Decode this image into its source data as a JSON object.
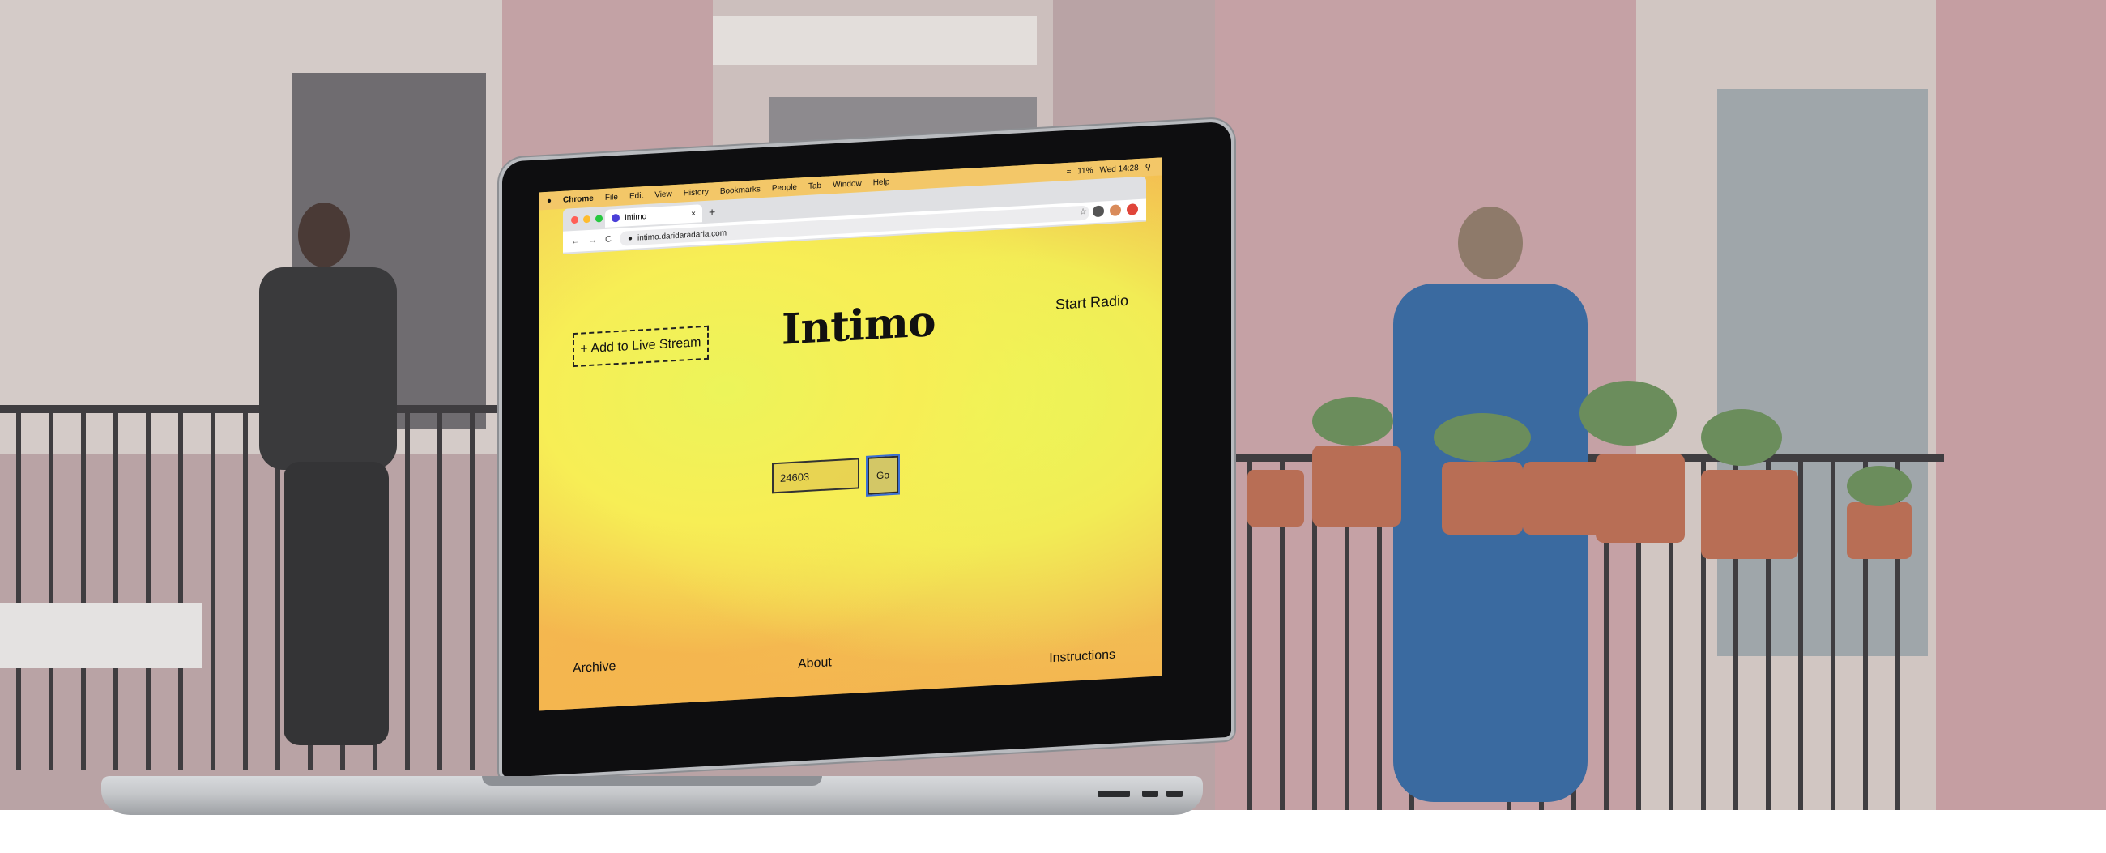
{
  "menubar": {
    "apple": "",
    "items": [
      "Chrome",
      "File",
      "Edit",
      "View",
      "History",
      "Bookmarks",
      "People",
      "Tab",
      "Window",
      "Help"
    ],
    "status_time": "Wed 14:28",
    "battery": "11%"
  },
  "browser": {
    "tab_title": "Intimo",
    "tab_close": "×",
    "new_tab": "+",
    "back": "←",
    "forward": "→",
    "reload": "C",
    "url": "intimo.daridaradaria.com",
    "star": "☆",
    "traffic_colors": [
      "#ff5f57",
      "#febc2e",
      "#28c840"
    ]
  },
  "page": {
    "add_stream": "+ Add to Live Stream",
    "logo": "Intimo",
    "start_radio": "Start Radio",
    "code_value": "24603",
    "go": "Go",
    "archive": "Archive",
    "about": "About",
    "instructions": "Instructions"
  },
  "colors": {
    "accent_yellow": "#ecf45a",
    "accent_orange": "#f3b04f",
    "focus_ring": "#3b6fd4"
  }
}
